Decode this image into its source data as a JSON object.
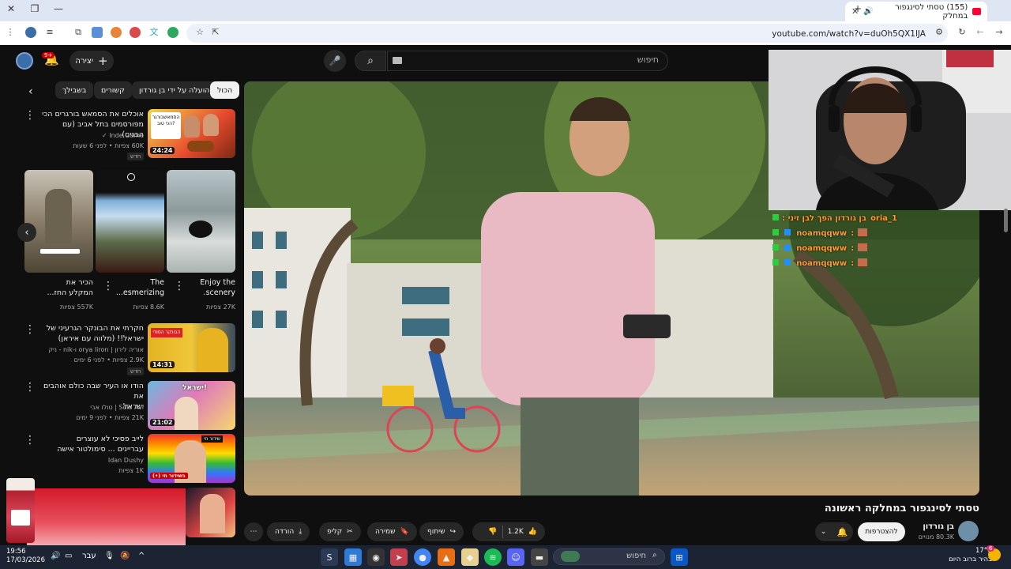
{
  "browser": {
    "tab_title": "(155) טסתי לסינגפור במחלק",
    "url": "youtube.com/watch?v=duOh5QX1lJA"
  },
  "header": {
    "search_placeholder": "חיפוש",
    "create_label": "יצירה",
    "notifications_count": "9+"
  },
  "chips": [
    "הכול",
    "הועלה על ידי בן גורדון",
    "קשורים",
    "בשבילך"
  ],
  "recommendations": [
    {
      "title_line1": "אוכלים את הסמאש בורגרים הכי",
      "title_line2": "מפורסמים בתל אביב (עם הבנים)",
      "channel": "Inde Game",
      "meta": "60K צפיות • לפני 6 שעות",
      "badge": "חדש",
      "duration": "24:24",
      "thumb_text": "הסמאשבורגר הכי טוב?"
    },
    {
      "title_line1": "חקרתי את הבונקר הגרעיני של",
      "title_line2": "ישראל!! (מלווה עם איראן)",
      "channel": "אוריה לירון | orya liron ו-nik - ניק",
      "meta": "2.9K צפיות • לפני 6 ימים",
      "badge": "חדש",
      "duration": "14:31",
      "thumb_text": "הבונקר הסודי"
    },
    {
      "title_line1": "הודו או העיר שבה כולם אוהבים את",
      "title_line2": "ישראל",
      "channel": "Solo Avi | טולו אבי",
      "meta": "21K צפיות • לפני 9 ימים",
      "duration": "21:02",
      "thumb_text": "ישראל!"
    },
    {
      "title_line1": "לייב פסיכי לא עוצרים",
      "title_line2": "עבריינים ... סימולטור אישה",
      "channel": "Idan Dushy",
      "meta": "1K צפיות",
      "thumb_text": "שידור חי",
      "live_label": "(•) בשידור חי"
    }
  ],
  "shorts": [
    {
      "title_line1": "Enjoy the",
      "title_line2": "scenery.",
      "views": "27K צפיות"
    },
    {
      "title_line1": "The",
      "title_line2": "esmerizing...",
      "views": "8.6K צפיות"
    },
    {
      "title_line1": "הכיר את",
      "title_line2": "המקלע החז...",
      "views": "557K צפיות"
    }
  ],
  "overlay_chat": [
    {
      "user": "oria_1",
      "text": ": בן גורדון הפך לבן זיני"
    },
    {
      "user": "noamqqww",
      "text": ":"
    },
    {
      "user": "noamqqww",
      "text": ":"
    },
    {
      "user": "noamqqww",
      "text": ":"
    }
  ],
  "video": {
    "title": "טסתי לסינגפור במחלקה ראשונה",
    "channel": "בן גורדון",
    "subscribers": "80.3K מנויים",
    "subscribe_label": "להצטרפות",
    "likes": "1.2K",
    "share_label": "שיתוף",
    "save_label": "שמירה",
    "clip_label": "קליפ",
    "download_label": "הורדה"
  },
  "taskbar": {
    "search_label": "חיפוש",
    "time": "19:56",
    "date": "17/03/2026",
    "lang": "עבר",
    "temp": "17°C",
    "weather": "בהיר ברוב היום",
    "badge": "6"
  },
  "colors": {
    "background": "#0f0f0f",
    "chip": "#272727",
    "accent_red": "#ff0033",
    "chat_user": "#ff9d2e"
  }
}
